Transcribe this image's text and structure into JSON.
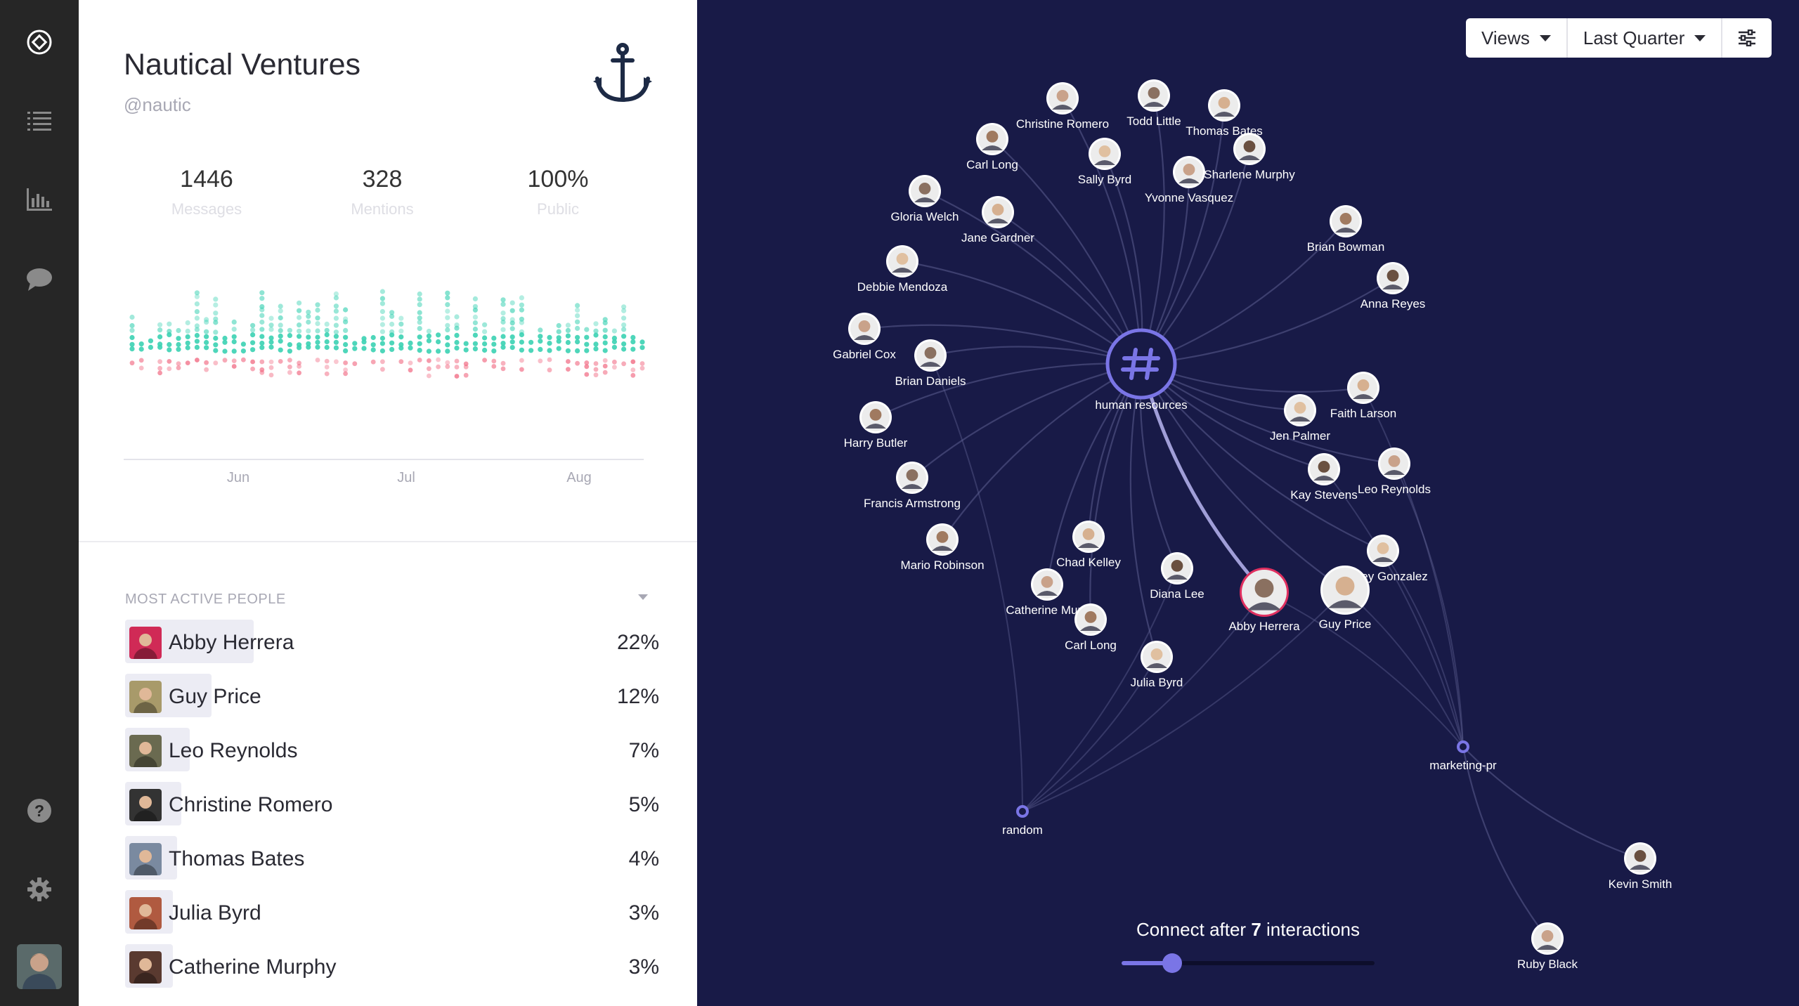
{
  "nav": {
    "items": [
      {
        "name": "home-icon"
      },
      {
        "name": "list-icon"
      },
      {
        "name": "bar-chart-icon"
      },
      {
        "name": "chat-bubble-icon"
      },
      {
        "name": "help-icon"
      },
      {
        "name": "gear-icon"
      }
    ]
  },
  "team": {
    "name": "Nautical Ventures",
    "handle": "@nautic",
    "logo_icon": "anchor-icon"
  },
  "stats": [
    {
      "value": "1446",
      "label": "Messages"
    },
    {
      "value": "328",
      "label": "Mentions"
    },
    {
      "value": "100%",
      "label": "Public"
    }
  ],
  "activity_chart": {
    "x_labels": [
      "Jun",
      "Jul",
      "Aug"
    ],
    "colors": {
      "positive": "#3bd1b3",
      "negative": "#f0607a"
    }
  },
  "most_active": {
    "title": "MOST ACTIVE PEOPLE",
    "people": [
      {
        "name": "Abby Herrera",
        "percent": "22%",
        "share": 0.22,
        "avatar_color": "#d02a56"
      },
      {
        "name": "Guy Price",
        "percent": "12%",
        "share": 0.12,
        "avatar_color": "#a89a6a"
      },
      {
        "name": "Leo Reynolds",
        "percent": "7%",
        "share": 0.07,
        "avatar_color": "#6a6a50"
      },
      {
        "name": "Christine Romero",
        "percent": "5%",
        "share": 0.05,
        "avatar_color": "#333333"
      },
      {
        "name": "Thomas Bates",
        "percent": "4%",
        "share": 0.04,
        "avatar_color": "#7a8aa0"
      },
      {
        "name": "Julia Byrd",
        "percent": "3%",
        "share": 0.03,
        "avatar_color": "#b05a40"
      },
      {
        "name": "Catherine Murphy",
        "percent": "3%",
        "share": 0.03,
        "avatar_color": "#5a3a30"
      }
    ]
  },
  "toolbar": {
    "views_label": "Views",
    "period_label": "Last Quarter",
    "filter_icon": "sliders-icon"
  },
  "network": {
    "hub": {
      "label": "human resources",
      "icon": "hashtag-icon"
    },
    "channels": [
      {
        "label": "marketing-pr"
      },
      {
        "label": "random"
      }
    ],
    "people": [
      {
        "label": "Christine Romero"
      },
      {
        "label": "Todd Little"
      },
      {
        "label": "Thomas Bates"
      },
      {
        "label": "Carl Long"
      },
      {
        "label": "Sally Byrd"
      },
      {
        "label": "Sharlene Murphy"
      },
      {
        "label": "Yvonne Vasquez"
      },
      {
        "label": "Gloria Welch"
      },
      {
        "label": "Jane Gardner"
      },
      {
        "label": "Brian Bowman"
      },
      {
        "label": "Debbie Mendoza"
      },
      {
        "label": "Anna Reyes"
      },
      {
        "label": "Gabriel Cox"
      },
      {
        "label": "Brian Daniels"
      },
      {
        "label": "Faith Larson"
      },
      {
        "label": "Harry Butler"
      },
      {
        "label": "Jen Palmer"
      },
      {
        "label": "Kay Stevens"
      },
      {
        "label": "Leo Reynolds"
      },
      {
        "label": "Francis Armstrong"
      },
      {
        "label": "Chad Kelley"
      },
      {
        "label": "Mario Robinson"
      },
      {
        "label": "Ashley Gonzalez"
      },
      {
        "label": "Diana Lee"
      },
      {
        "label": "Catherine Murp"
      },
      {
        "label": "Abby Herrera"
      },
      {
        "label": "Guy Price"
      },
      {
        "label": "Carl Long"
      },
      {
        "label": "Julia Byrd"
      },
      {
        "label": "Kevin Smith"
      },
      {
        "label": "Ruby Black"
      }
    ]
  },
  "slider": {
    "prefix": "Connect after",
    "value": "7",
    "suffix": "interactions",
    "fraction": 0.2
  },
  "colors": {
    "background": "#181a47",
    "accent": "#7a75e6",
    "edge": "#5c5e8f"
  }
}
